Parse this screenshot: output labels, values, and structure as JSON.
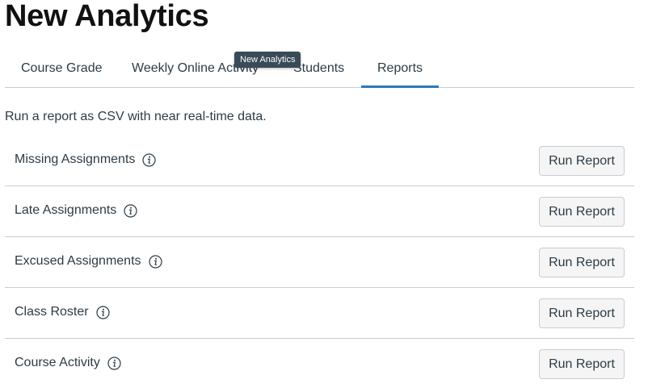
{
  "page": {
    "title": "New Analytics"
  },
  "tabs": [
    {
      "label": "Course Grade",
      "active": false
    },
    {
      "label": "Weekly Online Activity",
      "active": false
    },
    {
      "label": "Students",
      "active": false
    },
    {
      "label": "Reports",
      "active": true
    }
  ],
  "tooltip": {
    "text": "New Analytics"
  },
  "intro": "Run a report as CSV with near real-time data.",
  "reports": [
    {
      "name": "Missing Assignments",
      "button": "Run Report"
    },
    {
      "name": "Late Assignments",
      "button": "Run Report"
    },
    {
      "name": "Excused Assignments",
      "button": "Run Report"
    },
    {
      "name": "Class Roster",
      "button": "Run Report"
    },
    {
      "name": "Course Activity",
      "button": "Run Report"
    }
  ],
  "icons": {
    "info": "info-icon"
  },
  "colors": {
    "active_tab_underline": "#2b7abc",
    "text": "#2d3b45",
    "divider": "#c7cdd1",
    "tooltip_bg": "#394b58",
    "button_bg": "#f5f5f5"
  }
}
